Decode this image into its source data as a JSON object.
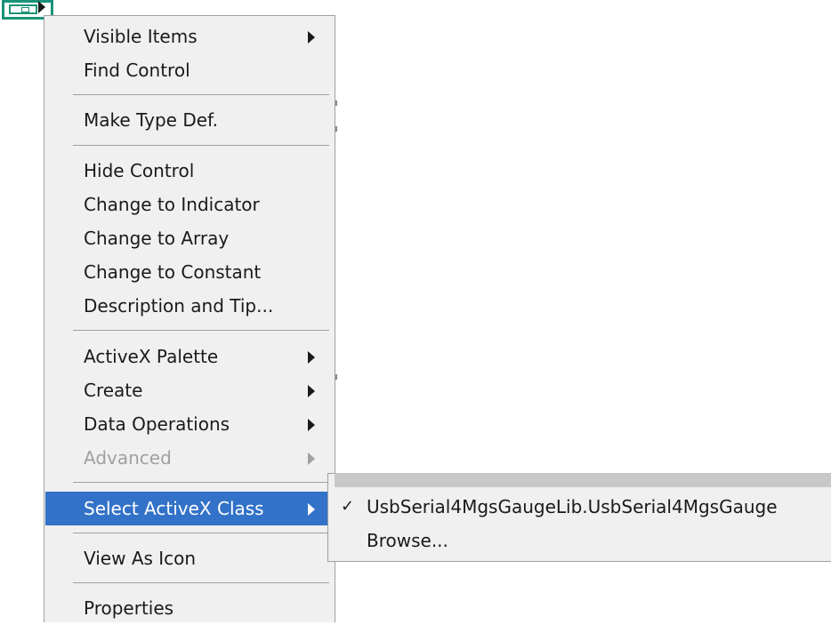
{
  "context_menu": {
    "groups": [
      [
        {
          "label": "Visible Items",
          "submenu": true,
          "enabled": true
        },
        {
          "label": "Find Control",
          "submenu": false,
          "enabled": true
        }
      ],
      [
        {
          "label": "Make Type Def.",
          "submenu": false,
          "enabled": true
        }
      ],
      [
        {
          "label": "Hide Control",
          "submenu": false,
          "enabled": true
        },
        {
          "label": "Change to Indicator",
          "submenu": false,
          "enabled": true
        },
        {
          "label": "Change to Array",
          "submenu": false,
          "enabled": true
        },
        {
          "label": "Change to Constant",
          "submenu": false,
          "enabled": true
        },
        {
          "label": "Description and Tip...",
          "submenu": false,
          "enabled": true
        }
      ],
      [
        {
          "label": "ActiveX Palette",
          "submenu": true,
          "enabled": true
        },
        {
          "label": "Create",
          "submenu": true,
          "enabled": true
        },
        {
          "label": "Data Operations",
          "submenu": true,
          "enabled": true
        },
        {
          "label": "Advanced",
          "submenu": true,
          "enabled": false
        }
      ],
      [
        {
          "label": "Select ActiveX Class",
          "submenu": true,
          "enabled": true,
          "selected": true
        }
      ],
      [
        {
          "label": "View As Icon",
          "submenu": false,
          "enabled": true
        }
      ],
      [
        {
          "label": "Properties",
          "submenu": false,
          "enabled": true
        }
      ]
    ]
  },
  "submenu": {
    "items": [
      {
        "label": "UsbSerial4MgsGaugeLib.UsbSerial4MgsGauge",
        "checked": true,
        "check_mark": "✓"
      },
      {
        "label": "Browse...",
        "checked": false,
        "check_mark": ""
      }
    ]
  },
  "colors": {
    "highlight": "#3272c8",
    "terminal_border": "#1a9379",
    "menu_bg": "#f0f0f0",
    "disabled_text": "#a0a0a0"
  },
  "icons": {
    "terminal": "activex-refnum-terminal-icon",
    "submenu_arrow": "chevron-right-icon",
    "check": "checkmark-icon"
  }
}
